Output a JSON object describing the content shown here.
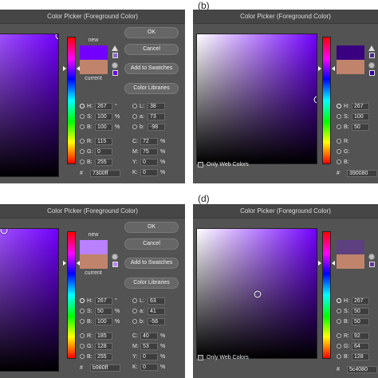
{
  "dialog_title": "Color Picker (Foreground Color)",
  "panel_labels": {
    "b": "(b)",
    "d": "(d)"
  },
  "swatch_labels": {
    "new": "new",
    "current": "current"
  },
  "buttons": {
    "ok": "OK",
    "cancel": "Cancel",
    "add_to_swatches": "Add to Swatches",
    "color_libraries": "Color Libraries"
  },
  "only_web_colors": "Only Web Colors",
  "field_labels": {
    "H": "H:",
    "S": "S:",
    "B": "B:",
    "R": "R:",
    "G": "G:",
    "Bb": "B:",
    "L": "L:",
    "a": "a:",
    "b": "b:",
    "C": "C:",
    "M": "M:",
    "Y": "Y:",
    "K": "K:",
    "hex": "#"
  },
  "units": {
    "deg": "°",
    "pct": "%"
  },
  "pickers": {
    "a": {
      "new_color": "#7300ff",
      "H": "267",
      "S": "100",
      "B": "100",
      "R": "115",
      "G": "0",
      "Bb": "255",
      "L": "38",
      "a": "73",
      "b": "-98",
      "C": "72",
      "M": "75",
      "Y": "0",
      "K": "0",
      "hex": "7300ff"
    },
    "b": {
      "new_color": "#390080",
      "H": "267",
      "S": "100",
      "B": "50",
      "hex": "390080"
    },
    "c": {
      "new_color": "#b980ff",
      "H": "267",
      "S": "50",
      "B": "100",
      "R": "185",
      "G": "128",
      "Bb": "255",
      "L": "63",
      "a": "41",
      "b": "-56",
      "C": "40",
      "M": "53",
      "Y": "0",
      "K": "0",
      "hex": "b980ff"
    },
    "d": {
      "new_color": "#5c4080",
      "H": "267",
      "S": "50",
      "B": "50",
      "R": "92",
      "G": "64",
      "Bb": "128",
      "hex": "5c4080"
    }
  },
  "hue_color": "#7300ff"
}
